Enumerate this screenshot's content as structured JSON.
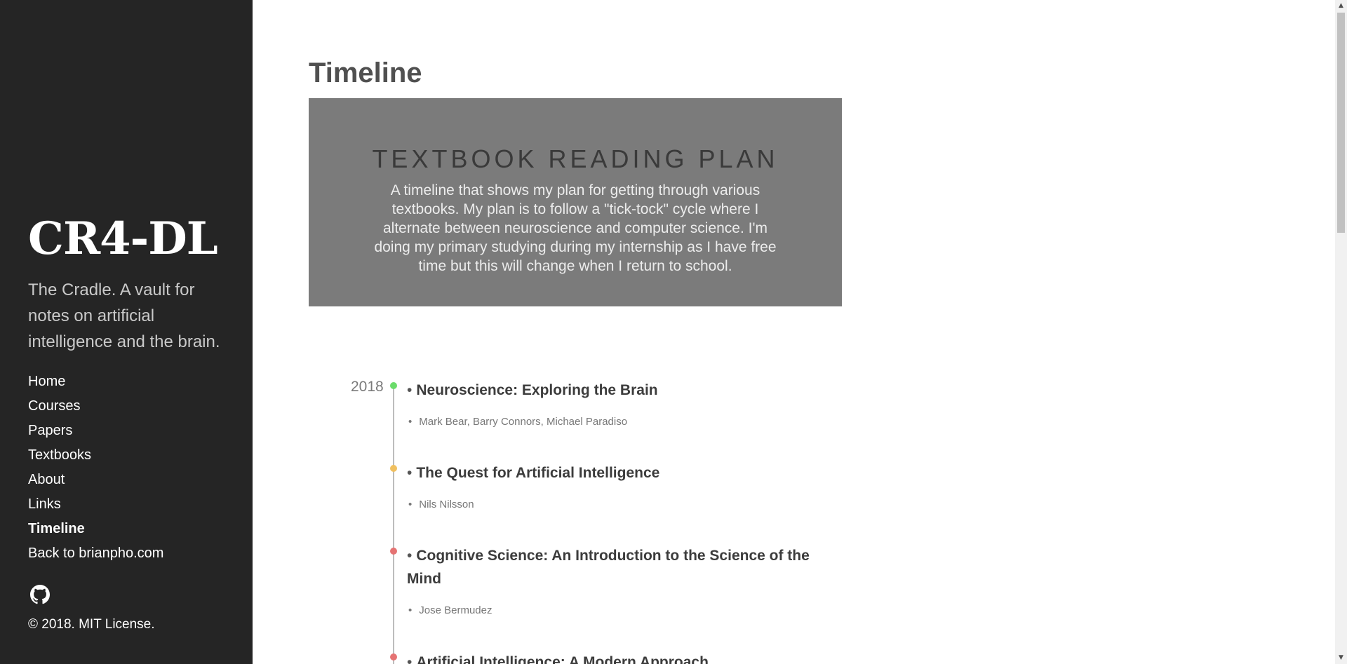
{
  "sidebar": {
    "brand": "CR4-DL",
    "tagline": "The Cradle. A vault for notes on artificial intelligence and the brain.",
    "nav": [
      {
        "label": "Home",
        "active": false
      },
      {
        "label": "Courses",
        "active": false
      },
      {
        "label": "Papers",
        "active": false
      },
      {
        "label": "Textbooks",
        "active": false
      },
      {
        "label": "About",
        "active": false
      },
      {
        "label": "Links",
        "active": false
      },
      {
        "label": "Timeline",
        "active": true
      },
      {
        "label": "Back to brianpho.com",
        "active": false
      }
    ],
    "github_icon": "github-icon",
    "copyright": "© 2018. MIT License."
  },
  "main": {
    "page_title": "Timeline",
    "hero": {
      "title": "TEXTBOOK READING PLAN",
      "description": "A timeline that shows my plan for getting through various textbooks. My plan is to follow a \"tick-tock\" cycle where I alternate between neuroscience and computer science. I'm doing my primary studying during my internship as I have free time but this will change when I return to school."
    },
    "timeline": {
      "year": "2018",
      "items": [
        {
          "title": "Neuroscience: Exploring the Brain",
          "authors": "Mark Bear, Barry Connors, Michael Paradiso",
          "dot_color": "#6bdc6b"
        },
        {
          "title": "The Quest for Artificial Intelligence",
          "authors": "Nils Nilsson",
          "dot_color": "#f0c060"
        },
        {
          "title": "Cognitive Science: An Introduction to the Science of the Mind",
          "authors": "Jose Bermudez",
          "dot_color": "#e57373"
        },
        {
          "title": "Artificial Intelligence: A Modern Approach",
          "authors": "",
          "dot_color": "#e57373"
        }
      ]
    }
  }
}
